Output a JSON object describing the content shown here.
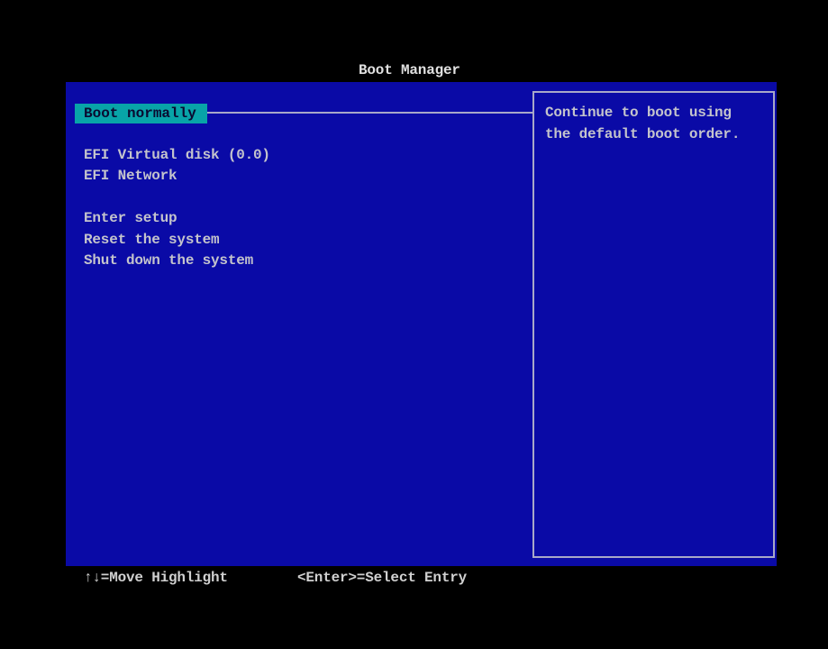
{
  "title": "Boot Manager",
  "menu": {
    "selected": "Boot normally",
    "items": [
      "EFI Virtual disk (0.0)",
      "EFI Network",
      "Enter setup",
      "Reset the system",
      "Shut down the system"
    ]
  },
  "help": {
    "lines": [
      "Continue to boot using",
      "the default boot order."
    ]
  },
  "footer": {
    "move": "↑↓=Move Highlight",
    "select": "<Enter>=Select Entry"
  },
  "colors": {
    "background": "#0a0aa6",
    "highlight": "#08a4a8",
    "text": "#c4c4cc"
  }
}
